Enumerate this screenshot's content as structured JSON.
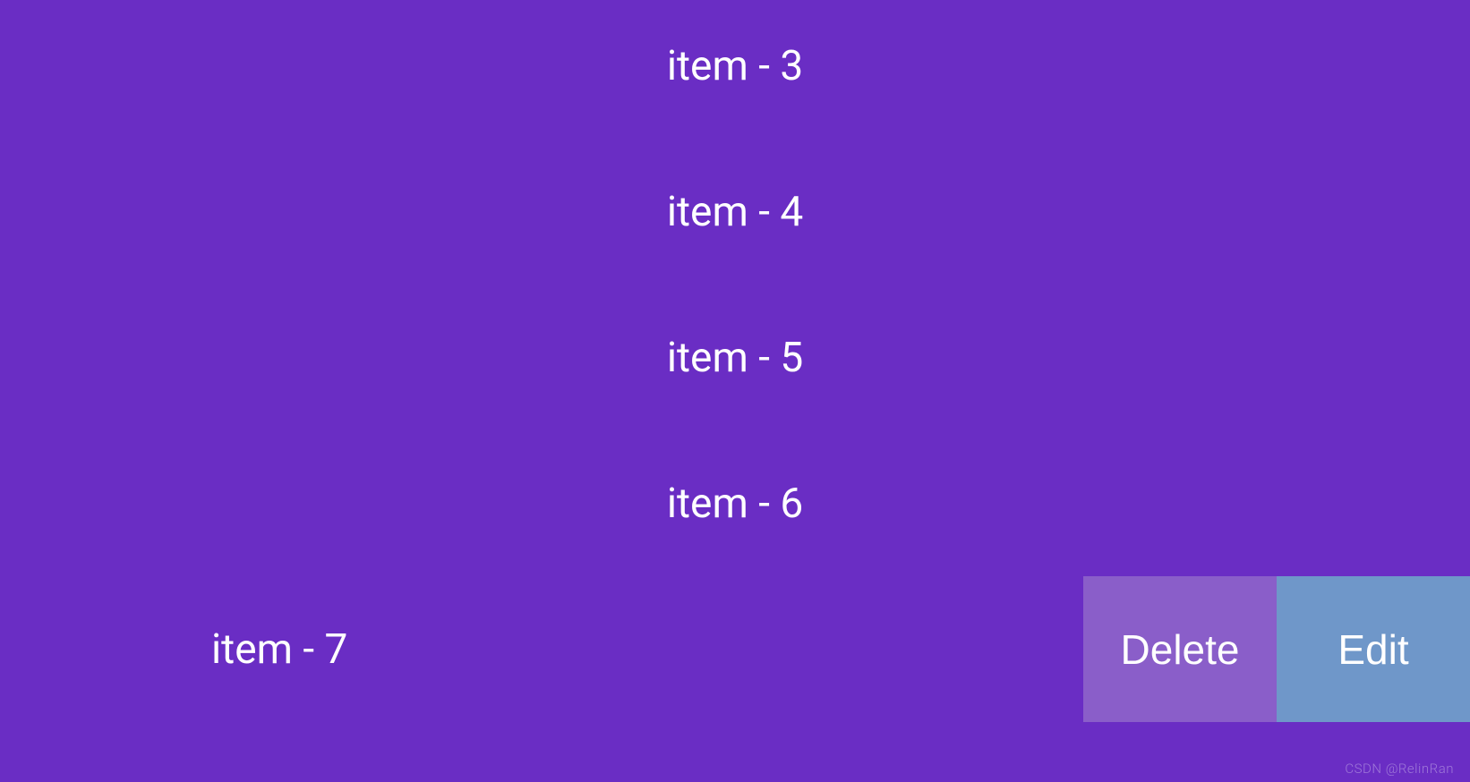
{
  "list": {
    "items": [
      {
        "label": "item - 3"
      },
      {
        "label": "item - 4"
      },
      {
        "label": "item - 5"
      },
      {
        "label": "item - 6"
      },
      {
        "label": "item - 7"
      }
    ]
  },
  "actions": {
    "delete_label": "Delete",
    "edit_label": "Edit"
  },
  "watermark": "CSDN @RelinRan",
  "colors": {
    "background": "#6a2dc4",
    "delete_bg": "#8a5ec9",
    "edit_bg": "#6f97c9",
    "text": "#ffffff"
  }
}
